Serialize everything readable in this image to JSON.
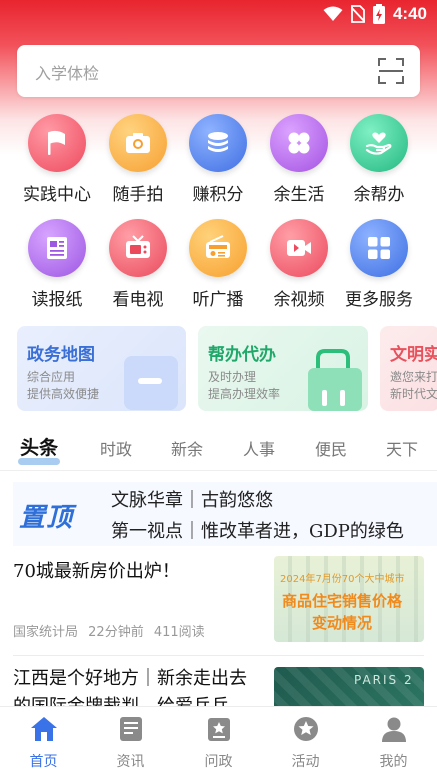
{
  "status": {
    "time": "4:40"
  },
  "search": {
    "placeholder": "入学体检"
  },
  "grid": [
    {
      "label": "实践中心",
      "icon": "flag-icon",
      "color": "#f0596a"
    },
    {
      "label": "随手拍",
      "icon": "camera-icon",
      "color": "#f9a23b"
    },
    {
      "label": "赚积分",
      "icon": "coins-icon",
      "color": "#4b7de8"
    },
    {
      "label": "余生活",
      "icon": "clover-icon",
      "color": "#b15fe6"
    },
    {
      "label": "余帮办",
      "icon": "heart-hand-icon",
      "color": "#32c08e"
    },
    {
      "label": "读报纸",
      "icon": "newspaper-icon",
      "color": "#a463e6"
    },
    {
      "label": "看电视",
      "icon": "tv-icon",
      "color": "#ef5668"
    },
    {
      "label": "听广播",
      "icon": "radio-icon",
      "color": "#f9a33a"
    },
    {
      "label": "余视频",
      "icon": "video-icon",
      "color": "#f05a6a"
    },
    {
      "label": "更多服务",
      "icon": "more-services-icon",
      "color": "#4b7ee8"
    }
  ],
  "cards": [
    {
      "title": "政务地图",
      "line1": "综合应用",
      "line2": "提供高效便捷",
      "color": "#3a6fd6"
    },
    {
      "title": "帮办代办",
      "line1": "及时办理",
      "line2": "提高办理效率",
      "color": "#20a86a"
    },
    {
      "title": "文明实",
      "line1": "邀您来打",
      "line2": "新时代文",
      "color": "#e8525d"
    }
  ],
  "tabs": [
    "头条",
    "时政",
    "新余",
    "人事",
    "便民",
    "天下"
  ],
  "pinned": {
    "badge": "置顶",
    "line1": "文脉华章｜古韵悠悠",
    "line2": "第一视点｜惟改革者进，GDP的绿色"
  },
  "news": [
    {
      "title": "70城最新房价出炉！",
      "source": "国家统计局",
      "time": "22分钟前",
      "reads": "411阅读",
      "thumb_text1": "2024年7月份70个大中城市",
      "thumb_text2": "商品住宅销售价格",
      "thumb_text3": "变动情况"
    },
    {
      "title": "江西是个好地方｜新余走出去的国际金牌裁判，给爱乒乓",
      "thumb_text": "PARIS 2"
    }
  ],
  "bottom_nav": [
    {
      "label": "首页",
      "icon": "home-icon"
    },
    {
      "label": "资讯",
      "icon": "news-icon"
    },
    {
      "label": "问政",
      "icon": "inquiry-icon"
    },
    {
      "label": "活动",
      "icon": "activity-icon"
    },
    {
      "label": "我的",
      "icon": "profile-icon"
    }
  ]
}
